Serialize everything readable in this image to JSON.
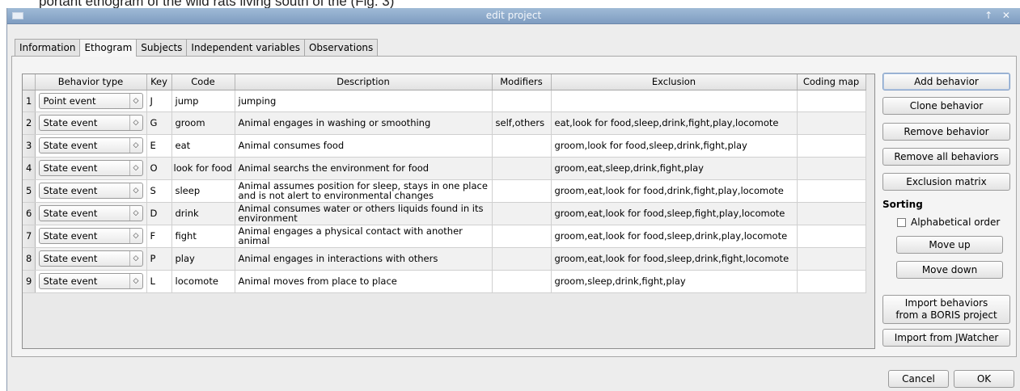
{
  "caption": "portant ethogram of the wild rats living south of the (Fig. 3)",
  "window": {
    "title": "edit project",
    "controls": "↑ ✕"
  },
  "tabs": [
    {
      "label": "Information",
      "active": false
    },
    {
      "label": "Ethogram",
      "active": true
    },
    {
      "label": "Subjects",
      "active": false
    },
    {
      "label": "Independent variables",
      "active": false
    },
    {
      "label": "Observations",
      "active": false
    }
  ],
  "table": {
    "headers": [
      "Behavior type",
      "Key",
      "Code",
      "Description",
      "Modifiers",
      "Exclusion",
      "Coding map"
    ],
    "rows": [
      {
        "num": "1",
        "type": "Point event",
        "key": "J",
        "code": "jump",
        "description": "jumping",
        "modifiers": "",
        "exclusion": "",
        "coding_map": ""
      },
      {
        "num": "2",
        "type": "State event",
        "key": "G",
        "code": "groom",
        "description": "Animal engages in washing or smoothing",
        "modifiers": "self,others",
        "exclusion": "eat,look for food,sleep,drink,fight,play,locomote",
        "coding_map": ""
      },
      {
        "num": "3",
        "type": "State event",
        "key": "E",
        "code": "eat",
        "description": "Animal consumes food",
        "modifiers": "",
        "exclusion": "groom,look for food,sleep,drink,fight,play",
        "coding_map": ""
      },
      {
        "num": "4",
        "type": "State event",
        "key": "O",
        "code": "look for food",
        "description": "Animal searchs the environment for food",
        "modifiers": "",
        "exclusion": "groom,eat,sleep,drink,fight,play",
        "coding_map": ""
      },
      {
        "num": "5",
        "type": "State event",
        "key": "S",
        "code": "sleep",
        "description": "Animal assumes position for sleep, stays in one place and is not alert to environmental changes",
        "modifiers": "",
        "exclusion": "groom,eat,look for food,drink,fight,play,locomote",
        "coding_map": ""
      },
      {
        "num": "6",
        "type": "State event",
        "key": "D",
        "code": "drink",
        "description": "Animal consumes water or others liquids found in its environment",
        "modifiers": "",
        "exclusion": "groom,eat,look for food,sleep,fight,play,locomote",
        "coding_map": ""
      },
      {
        "num": "7",
        "type": "State event",
        "key": "F",
        "code": "fight",
        "description": "Animal engages a physical contact with another animal",
        "modifiers": "",
        "exclusion": "groom,eat,look for food,sleep,drink,play,locomote",
        "coding_map": ""
      },
      {
        "num": "8",
        "type": "State event",
        "key": "P",
        "code": "play",
        "description": "Animal engages in interactions with others",
        "modifiers": "",
        "exclusion": "groom,eat,look for food,sleep,drink,fight,locomote",
        "coding_map": ""
      },
      {
        "num": "9",
        "type": "State event",
        "key": "L",
        "code": "locomote",
        "description": "Animal moves from place to place",
        "modifiers": "",
        "exclusion": "groom,sleep,drink,fight,play",
        "coding_map": ""
      }
    ]
  },
  "side_buttons": {
    "add_behavior": "Add behavior",
    "clone_behavior": "Clone behavior",
    "remove_behavior": "Remove behavior",
    "remove_all": "Remove all behaviors",
    "exclusion_matrix": "Exclusion matrix",
    "sorting_label": "Sorting",
    "alphabetical_order": "Alphabetical order",
    "move_up": "Move up",
    "move_down": "Move down",
    "import_boris_line1": "Import behaviors",
    "import_boris_line2": "from a BORIS project",
    "import_jwatcher": "Import from JWatcher"
  },
  "footer": {
    "cancel": "Cancel",
    "ok": "OK"
  },
  "icons": {
    "combo_arrow": "updown-chevron-icon"
  }
}
